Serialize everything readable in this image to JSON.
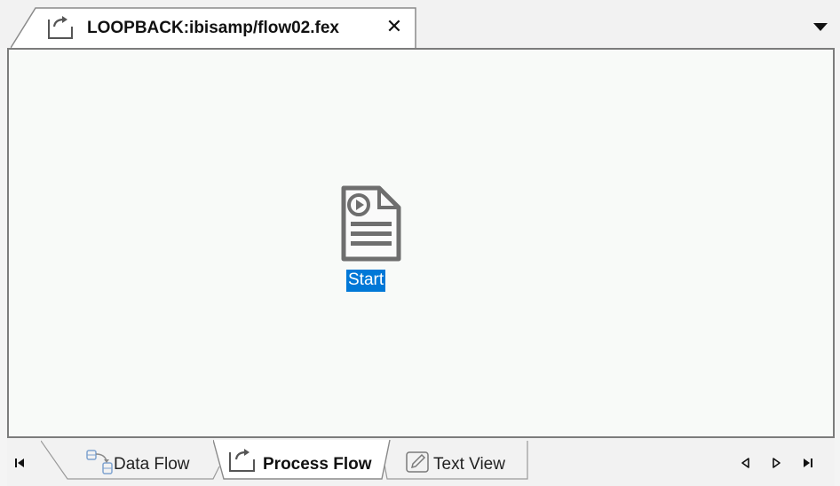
{
  "document_tab": {
    "title": "LOOPBACK:ibisamp/flow02.fex",
    "icon": "process-flow-icon",
    "close_label": "✕"
  },
  "tab_list_icon": "dropdown-triangle-icon",
  "canvas": {
    "node": {
      "label": "Start",
      "icon": "start-document-play-icon",
      "selected": true
    }
  },
  "bottom_tabs": [
    {
      "label": "Data Flow",
      "icon": "data-flow-icon",
      "active": false
    },
    {
      "label": "Process Flow",
      "icon": "process-flow-icon",
      "active": true
    },
    {
      "label": "Text View",
      "icon": "pencil-icon",
      "active": false
    }
  ],
  "navigation": {
    "first": "first-tab-icon",
    "previous": "previous-tab-icon",
    "next": "next-tab-icon",
    "last": "last-tab-icon"
  },
  "colors": {
    "selection": "#0078d7",
    "canvas_background": "#f8faf8",
    "icon_gray": "#6e6e6e"
  }
}
